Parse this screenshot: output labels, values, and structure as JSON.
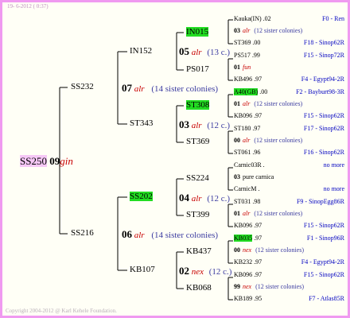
{
  "header": {
    "date": "19- 6-2012 ( 0:37)"
  },
  "footer": {
    "copyright": "Copyright 2004-2012 @ Karl Kehele Foundation."
  },
  "root": {
    "name": "SS250",
    "year": "09",
    "race": "gin"
  },
  "g1": [
    {
      "name": "SS232",
      "year": "07",
      "race": "alr",
      "sisters": "(14 sister colonies)"
    },
    {
      "name": "SS216",
      "year": "06",
      "race": "alr",
      "sisters": "(14 sister colonies)"
    }
  ],
  "g2": [
    {
      "name": "IN152",
      "year": "05",
      "race": "alr",
      "sisters": "(13 c.)"
    },
    {
      "name": "ST343",
      "year": "03",
      "race": "alr",
      "sisters": "(12 c.)"
    },
    {
      "name": "SS202",
      "year": "04",
      "race": "alr",
      "sisters": "(12 c.)"
    },
    {
      "name": "KB107",
      "year": "02",
      "race": "nex",
      "sisters": "(12 c.)"
    }
  ],
  "g3": [
    "IN015",
    "PS017",
    "ST308",
    "ST369",
    "SS224",
    "ST399",
    "KB437",
    "KB068"
  ],
  "g4": [
    {
      "name": "Kauka(IN)",
      "year": ".02",
      "ref": "F0 - Ren"
    },
    {
      "year": "03",
      "race": "alr",
      "sisters": "(12 sister colonies)"
    },
    {
      "name": "ST369",
      "year": ".00",
      "ref": "F18 - Sinop62R"
    },
    {
      "name": "PS517",
      "year": ".99",
      "ref": "F15 - Sinop72R"
    },
    {
      "year": "01",
      "race": "fun"
    },
    {
      "name": "KB496",
      "year": ".97",
      "ref": "F4 - Egypt94-2R"
    },
    {
      "name": "A40(GB)",
      "year": ".00",
      "ref": "F2 - Bayburt98-3R"
    },
    {
      "year": "01",
      "race": "alr",
      "sisters": "(12 sister colonies)"
    },
    {
      "name": "KB096",
      "year": ".97",
      "ref": "F15 - Sinop62R"
    },
    {
      "name": "ST180",
      "year": ".97",
      "ref": "F17 - Sinop62R"
    },
    {
      "year": "00",
      "race": "alr",
      "sisters": "(12 sister colonies)"
    },
    {
      "name": "ST061",
      "year": ".96",
      "ref": "F16 - Sinop62R"
    },
    {
      "name": "Carnic03R",
      "year": ".",
      "ref": "no more"
    },
    {
      "year": "03",
      "race": "pure carnica"
    },
    {
      "name": "CarnicM",
      "year": ".",
      "ref": "no more"
    },
    {
      "name": "ST031",
      "year": ".98",
      "ref": "F9 - SinopEgg86R"
    },
    {
      "year": "01",
      "race": "alr",
      "sisters": "(12 sister colonies)"
    },
    {
      "name": "KB096",
      "year": ".97",
      "ref": "F15 - Sinop62R"
    },
    {
      "name": "KB035",
      "year": ".97",
      "ref": "F1 - Sinop96R"
    },
    {
      "year": "00",
      "race": "nex",
      "sisters": "(12 sister colonies)"
    },
    {
      "name": "KB232",
      "year": ".97",
      "ref": "F4 - Egypt94-2R"
    },
    {
      "name": "KB096",
      "year": ".97",
      "ref": "F15 - Sinop62R"
    },
    {
      "year": "99",
      "race": "nex",
      "sisters": "(12 sister colonies)"
    },
    {
      "name": "KB189",
      "year": ".95",
      "ref": "F7 - Atlas85R"
    }
  ]
}
